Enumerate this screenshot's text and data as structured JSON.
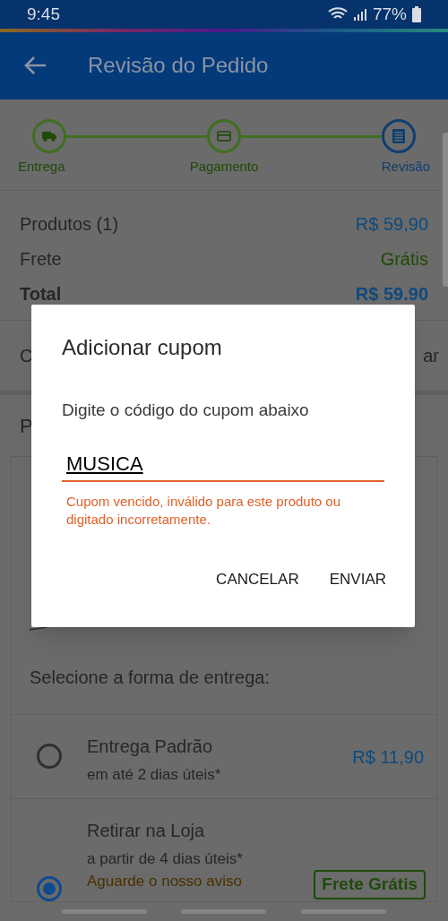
{
  "status_bar": {
    "time": "9:45",
    "battery": "77%"
  },
  "app_bar": {
    "title": "Revisão do Pedido"
  },
  "steps": [
    {
      "label": "Entrega",
      "selected": false
    },
    {
      "label": "Pagamento",
      "selected": false
    },
    {
      "label": "Revisão",
      "selected": true
    }
  ],
  "summary": [
    {
      "label": "Produtos (1)",
      "value": "R$ 59,90",
      "kind": "price"
    },
    {
      "label": "Frete",
      "value": "Grátis",
      "kind": "free"
    },
    {
      "label": "Total",
      "value": "R$ 59.90",
      "kind": "total"
    }
  ],
  "coupon_row": {
    "label": "C",
    "action": "ar"
  },
  "products_heading": "P",
  "delivery": {
    "heading": "Selecione a forma de entrega:",
    "options": [
      {
        "title": "Entrega Padrão",
        "subtitle": "em até 2 dias úteis*",
        "price": "R$ 11,90",
        "selected": false
      },
      {
        "title": "Retirar na Loja",
        "subtitle": "a partir de 4 dias úteis*",
        "note": "Aguarde o nosso aviso",
        "badge": "Frete Grátis",
        "selected": true
      }
    ]
  },
  "dialog": {
    "title": "Adicionar cupom",
    "message": "Digite o código do cupom abaixo",
    "value": "MUSICA",
    "error": "Cupom vencido, inválido para este produto ou digitado incorretamente.",
    "buttons": [
      "CANCELAR",
      "ENVIAR"
    ]
  }
}
